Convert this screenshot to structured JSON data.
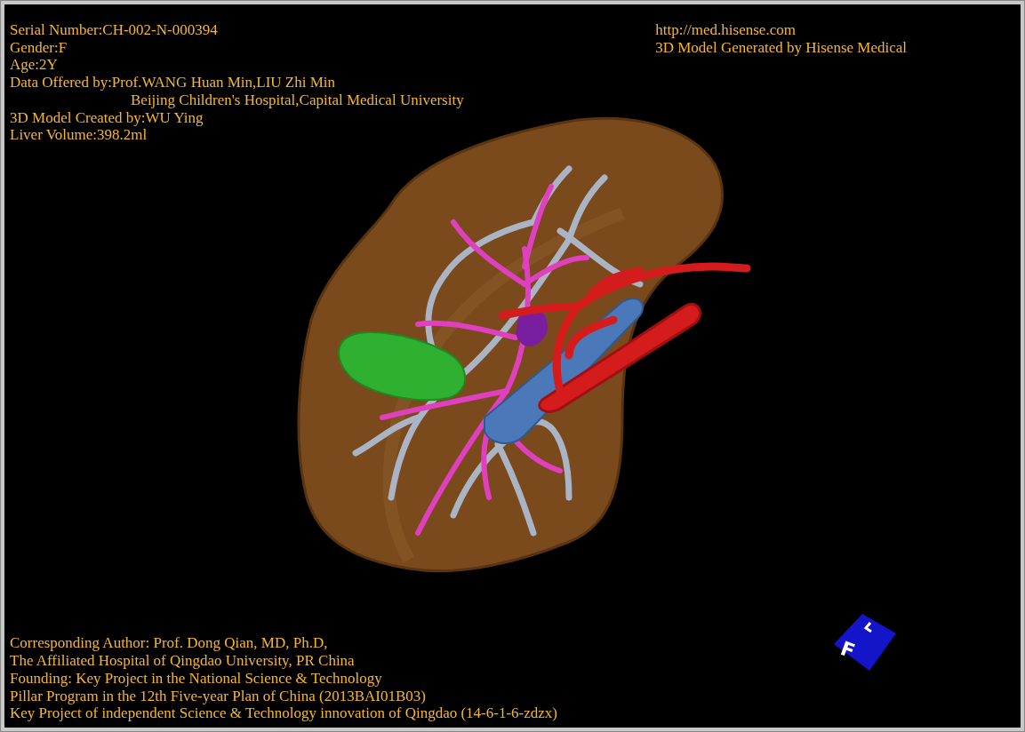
{
  "info": [
    {
      "text": "Serial Number:CH-002-N-000394",
      "indent": false
    },
    {
      "text": "Gender:F",
      "indent": false
    },
    {
      "text": "Age:2Y",
      "indent": false
    },
    {
      "text": "Data Offered by:Prof.WANG Huan Min,LIU Zhi Min",
      "indent": false
    },
    {
      "text": "Beijing Children's Hospital,Capital Medical University",
      "indent": true
    },
    {
      "text": "3D Model Created by:WU Ying",
      "indent": false
    },
    {
      "text": "Liver Volume:398.2ml",
      "indent": false
    }
  ],
  "credits": [
    "http://med.hisense.com",
    "3D Model Generated by Hisense Medical"
  ],
  "footer": [
    "Corresponding Author: Prof. Dong Qian, MD, Ph.D,",
    "The Affiliated Hospital of Qingdao University, PR China",
    "Founding: Key Project in the National Science & Technology",
    "Pillar Program in the 12th Five-year Plan of China (2013BAI01B03)",
    "Key Project of independent Science & Technology innovation of Qingdao (14-6-1-6-zdzx)"
  ],
  "orientation_cube": {
    "label": "F"
  }
}
